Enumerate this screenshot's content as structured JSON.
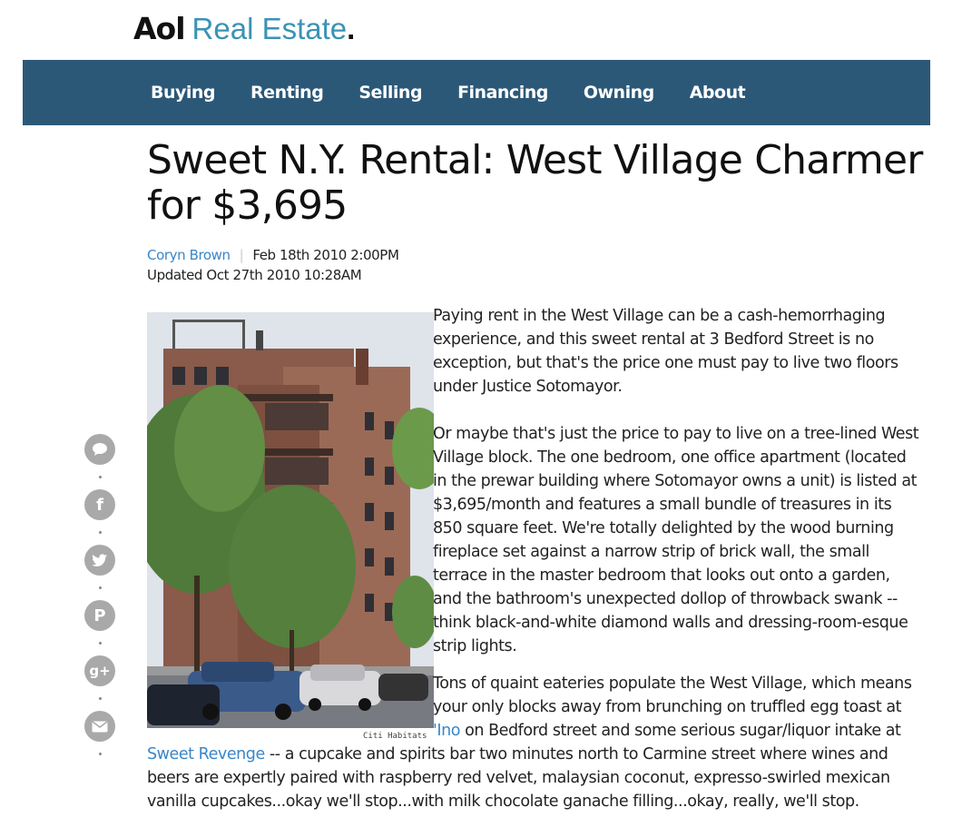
{
  "brand": {
    "aol": "Aol",
    "name": "Real Estate",
    "dot": "."
  },
  "nav": [
    {
      "label": "Buying"
    },
    {
      "label": "Renting"
    },
    {
      "label": "Selling"
    },
    {
      "label": "Financing"
    },
    {
      "label": "Owning"
    },
    {
      "label": "About"
    }
  ],
  "article": {
    "title": "Sweet N.Y. Rental: West Village Charmer for $3,695",
    "author": "Coryn Brown",
    "published": "Feb 18th 2010 2:00PM",
    "updated": "Updated Oct 27th 2010 10:28AM",
    "photo_credit": "Citi Habitats",
    "p1": "Paying rent in the West Village can be a cash-hemorrhaging experience, and this sweet rental at 3 Bedford Street is no exception, but that's the price one must pay to live two floors under Justice Sotomayor.",
    "p2": "Or maybe that's just the price to pay to live on a tree-lined West Village block. The one bedroom, one office apartment (located in the prewar building where Sotomayor owns a unit) is listed at $3,695/month and features a small bundle of treasures in its 850 square feet. We're totally delighted by the wood burning fireplace set against a narrow strip of brick wall, the small terrace in the master bedroom that looks out onto a garden, and the bathroom's unexpected dollop of throwback swank -- think black-and-white diamond walls and dressing-room-esque strip lights.",
    "p3_a": "Tons of quaint eateries populate the West Village, which means your only blocks away from brunching on truffled egg toast at ",
    "p3_link1": "'Ino",
    "p3_b": " on Bedford street and some serious sugar/liquor intake at",
    "p3_link2": "Sweet Revenge",
    "p3_c": " -- a cupcake and spirits bar two minutes north to Carmine street where wines and beers are expertly paired with raspberry red velvet, malaysian coconut, expresso-swirled mexican vanilla cupcakes...okay we'll stop...with milk chocolate ganache filling...okay, really, we'll stop."
  },
  "share": [
    {
      "icon": "comment-icon"
    },
    {
      "icon": "facebook-icon",
      "glyph": "f"
    },
    {
      "icon": "twitter-icon"
    },
    {
      "icon": "pinterest-icon",
      "glyph": "P"
    },
    {
      "icon": "google-plus-icon",
      "glyph": "g+"
    },
    {
      "icon": "email-icon"
    }
  ],
  "colors": {
    "nav_bg": "#2c5878",
    "link": "#3a86c8",
    "brand_accent": "#3a93b4",
    "share_bg": "#a9a9a9"
  }
}
